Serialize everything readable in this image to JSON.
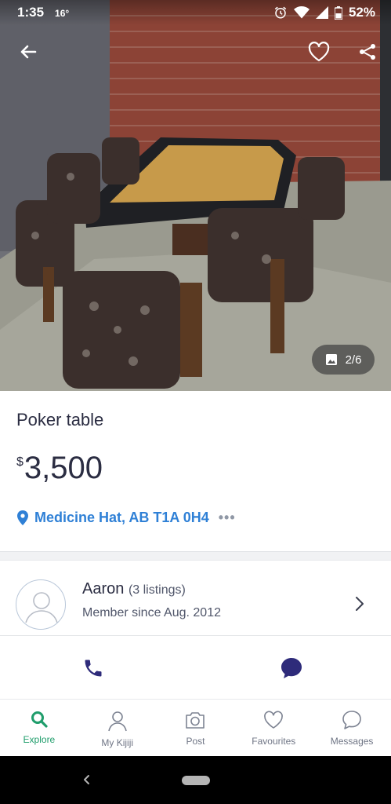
{
  "status_bar": {
    "time": "1:35",
    "temperature": "16°",
    "battery": "52%"
  },
  "header": {
    "back_icon": "arrow-left-icon",
    "favourite_icon": "heart-outline-icon",
    "share_icon": "share-icon"
  },
  "gallery": {
    "counter": "2/6",
    "counter_icon": "image-icon"
  },
  "listing": {
    "title": "Poker table",
    "price_currency": "$",
    "price_amount": "3,500",
    "location": "Medicine Hat, AB T1A 0H4",
    "location_more": "•••"
  },
  "seller": {
    "name": "Aaron",
    "listings": "(3 listings)",
    "member_since": "Member since Aug. 2012"
  },
  "contact": {
    "call_icon": "phone-icon",
    "chat_icon": "chat-bubble-icon"
  },
  "bottom_nav": [
    {
      "label": "Explore",
      "icon": "search-icon",
      "active": true
    },
    {
      "label": "My Kijiji",
      "icon": "person-icon",
      "active": false
    },
    {
      "label": "Post",
      "icon": "camera-icon",
      "active": false
    },
    {
      "label": "Favourites",
      "icon": "heart-icon",
      "active": false
    },
    {
      "label": "Messages",
      "icon": "message-icon",
      "active": false
    }
  ],
  "colors": {
    "accent_blue": "#2f80d6",
    "nav_active": "#1f9d6b",
    "icon_navy": "#2e2b7a",
    "text_dark": "#2b2d42"
  }
}
